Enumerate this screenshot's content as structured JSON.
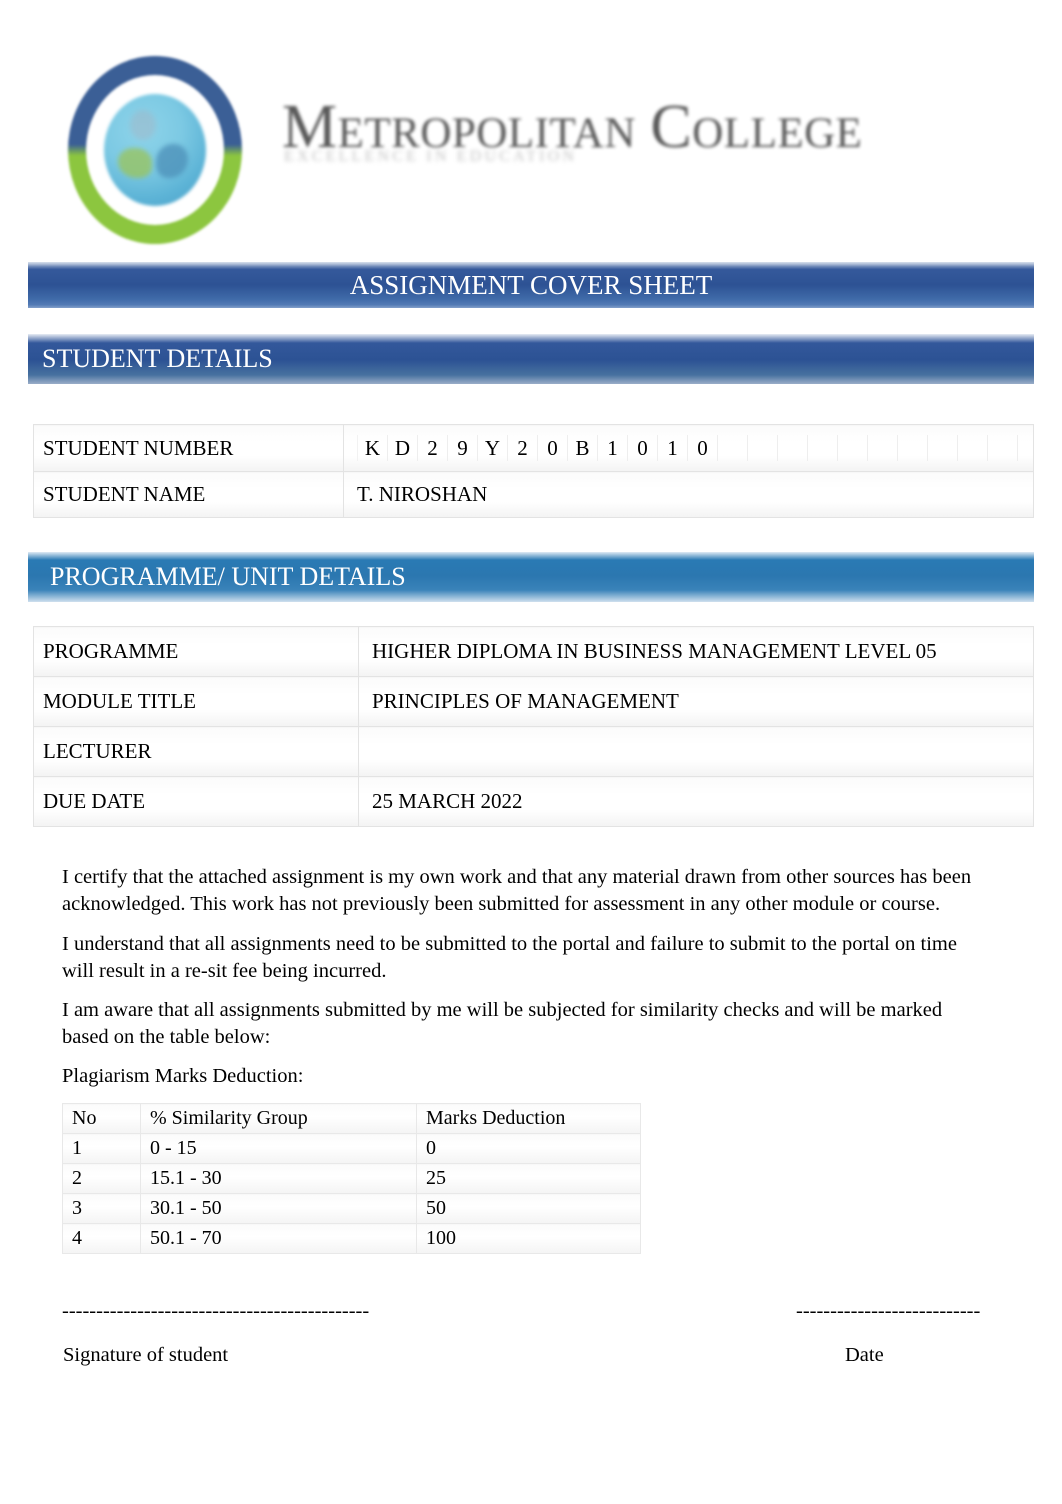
{
  "logo": {
    "wordmark_parts": [
      "M",
      "ETROPOLITAN",
      " C",
      "OLLEGE"
    ],
    "wordmark_text": "METROPOLITAN COLLEGE",
    "tagline": "EXCELLENCE IN EDUCATION"
  },
  "banners": {
    "title": "ASSIGNMENT COVER SHEET",
    "student_details": "STUDENT DETAILS",
    "programme_details": "PROGRAMME/ UNIT DETAILS"
  },
  "student_details": {
    "student_number_label": "STUDENT NUMBER",
    "student_number_chars": [
      "K",
      "D",
      "2",
      "9",
      "Y",
      "2",
      "0",
      "B",
      "1",
      "0",
      "1",
      "0",
      "",
      "",
      "",
      "",
      "",
      "",
      "",
      "",
      "",
      ""
    ],
    "student_name_label": "STUDENT NAME",
    "student_name_value": "T. NIROSHAN"
  },
  "programme_details": {
    "rows": [
      {
        "label": "PROGRAMME",
        "value": "HIGHER DIPLOMA IN BUSINESS MANAGEMENT LEVEL 05"
      },
      {
        "label": "MODULE TITLE",
        "value": "PRINCIPLES OF MANAGEMENT"
      },
      {
        "label": "LECTURER",
        "value": ""
      },
      {
        "label": "DUE DATE",
        "value": "25 MARCH 2022"
      }
    ]
  },
  "declaration": {
    "para_1": "I certify that the attached assignment is my own work and that any material drawn from other sources has been acknowledged. This work has not previously been submitted for assessment in any other module or course.",
    "para_2": "I understand that all assignments need to be submitted to the portal and failure to submit to the portal on time will result in a re-sit fee being incurred.",
    "para_3": "I am aware that all assignments submitted by me will be subjected for similarity checks and will be marked based on the table below:",
    "para_4": "Plagiarism Marks Deduction:"
  },
  "plagiarism_table": {
    "headers": [
      "No",
      "% Similarity Group",
      "Marks Deduction"
    ],
    "rows": [
      [
        "1",
        "0 - 15",
        "0"
      ],
      [
        "2",
        "15.1 - 30",
        "25"
      ],
      [
        "3",
        "30.1 - 50",
        "50"
      ],
      [
        "4",
        "50.1 - 70",
        "100"
      ]
    ]
  },
  "signature": {
    "student_line": "---------------------------------------------",
    "date_line": "---------------------------",
    "student_label": "Signature of student",
    "date_label": "Date"
  },
  "colors": {
    "banner_navy": "#2d5294",
    "banner_blue": "#2b77b0",
    "logo_ring_top": "#3b5f96",
    "logo_ring_bottom": "#8cc63f",
    "globe_blue": "#5cb3d6",
    "text": "#000000"
  }
}
